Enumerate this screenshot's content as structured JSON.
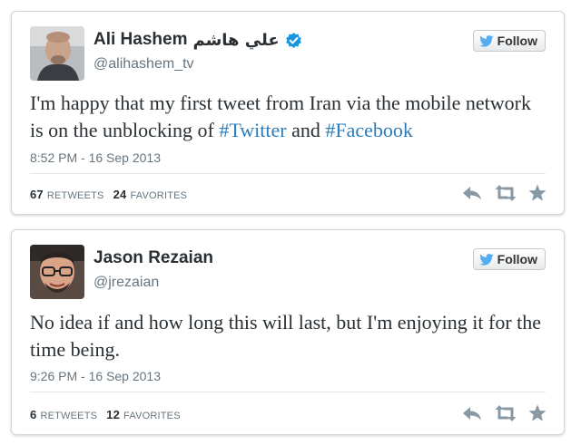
{
  "tweets": [
    {
      "display_name": "Ali Hashem",
      "alt_name": "علي هاشم",
      "handle": "@alihashem_tv",
      "follow_label": "Follow",
      "text_before": "I'm happy that my first tweet from Iran via the mobile network is on the unblocking of ",
      "hashtag_1": "#Twitter",
      "text_middle": " and ",
      "hashtag_2": "#Facebook",
      "timestamp": "8:52 PM - 16 Sep 2013",
      "retweets_count": "67",
      "retweets_label": "RETWEETS",
      "favorites_count": "24",
      "favorites_label": "FAVORITES",
      "verified": true
    },
    {
      "display_name": "Jason Rezaian",
      "handle": "@jrezaian",
      "follow_label": "Follow",
      "text": "No idea if and how long this will last, but I'm enjoying it for the time being.",
      "timestamp": "9:26 PM - 16 Sep 2013",
      "retweets_count": "6",
      "retweets_label": "RETWEETS",
      "favorites_count": "12",
      "favorites_label": "FAVORITES",
      "verified": false
    }
  ],
  "icons": {
    "verified": "verified-badge-icon",
    "follow": "twitter-bird-icon",
    "reply": "reply-icon",
    "retweet": "retweet-icon",
    "favorite": "star-icon"
  },
  "colors": {
    "link": "#2b7bb9",
    "verified": "#1b95e0",
    "bird": "#55acee",
    "action_icon": "#8899a6",
    "muted": "#66757f"
  }
}
